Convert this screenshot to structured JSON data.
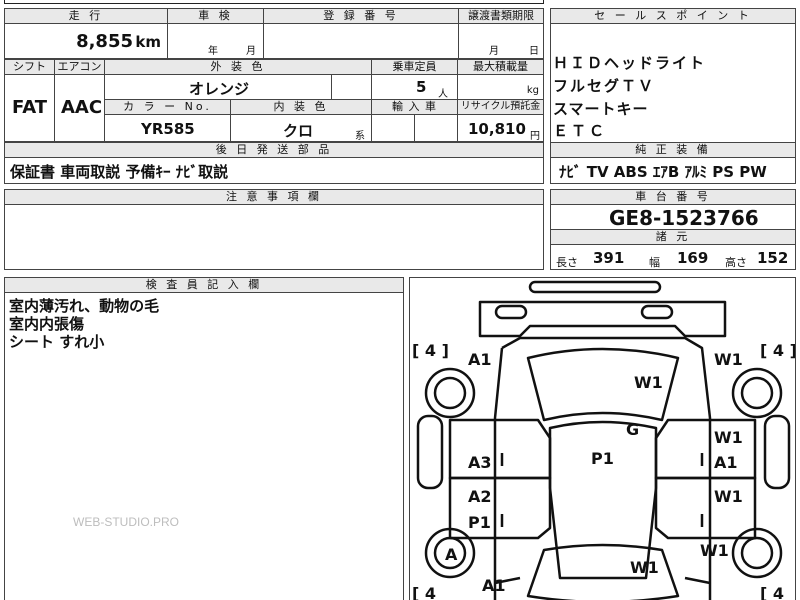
{
  "top": {
    "mileage_header": "走 行",
    "mileage_value": "8,855",
    "mileage_unit": "km",
    "shaken_header": "車 検",
    "shaken_year": "年",
    "shaken_month": "月",
    "reg_header": "登 録 番 号",
    "transfer_header": "譲渡書類期限",
    "transfer_month": "月",
    "transfer_day": "日"
  },
  "specs": {
    "shift_header": "シフト",
    "shift_value": "FAT",
    "ac_header": "エアコン",
    "ac_value": "AAC",
    "exterior_header": "外 装 色",
    "exterior_value": "オレンジ",
    "seats_header": "乗車定員",
    "seats_value": "5",
    "seats_unit": "人",
    "load_header": "最大積載量",
    "load_unit": "kg",
    "color_no_header": "カ ラ ー No.",
    "color_no_value": "YR585",
    "interior_header": "内 装 色",
    "interior_value": "クロ",
    "interior_suffix": "系",
    "import_header": "輸 入 車",
    "recycle_header": "リサイクル預託金",
    "recycle_value": "10,810",
    "recycle_unit": "円"
  },
  "sales_points": {
    "header": "セ ー ル ス ポ イ ン ト",
    "items": [
      "ＨＩＤヘッドライト",
      "フルセグＴＶ",
      "スマートキー",
      "ＥＴＣ"
    ]
  },
  "parts": {
    "header": "後 日 発 送 部 品",
    "value": "保証書 車両取説 予備ｷｰ ﾅﾋﾞ取説"
  },
  "equipment": {
    "header": "純 正 装 備",
    "value": "ﾅﾋﾞ TV ABS ｴｱB ｱﾙﾐ PS PW"
  },
  "notes": {
    "header": "注 意 事 項 欄",
    "value": ""
  },
  "chassis": {
    "header": "車 台 番 号",
    "value": "GE8-1523766"
  },
  "dimensions": {
    "header": "諸 元",
    "length_label": "長さ",
    "length_value": "391",
    "width_label": "幅",
    "width_value": "169",
    "height_label": "高さ",
    "height_value": "152"
  },
  "inspector": {
    "header": "検 査 員 記 入 欄",
    "lines": [
      "室内薄汚れ、動物の毛",
      "室内内張傷",
      "シート すれ小"
    ],
    "watermark": "WEB-STUDIO.PRO"
  },
  "diagram": {
    "tire_tl": "[ 4 ]",
    "tire_tr": "[ 4 ]",
    "tire_bl": "[ 4",
    "tire_br": "[ 4",
    "marks": {
      "a1_front_left": "A1",
      "w1_front_right": "W1",
      "w1_windshield": "W1",
      "g_roof": "G",
      "p1_roof": "P1",
      "w1_right_front_door": "W1",
      "a1_right_front_door": "A1",
      "a3_left_front_door": "A3",
      "a2_left_rear_door": "A2",
      "p1_left_rear_door": "P1",
      "w1_right_rear_door": "W1",
      "w1_right_rear_quarter": "W1",
      "a_left_rear_wheel": "A",
      "w1_rear_glass": "W1",
      "a1_rear_left": "A1"
    }
  }
}
